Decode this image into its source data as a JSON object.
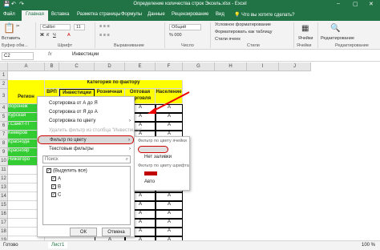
{
  "title": "Определение количества строк Эксель.xlsx - Excel",
  "tabs": [
    "Файл",
    "Главная",
    "Вставка",
    "Разметка страницы",
    "Формулы",
    "Данные",
    "Рецензирование",
    "Вид",
    "Что вы хотите сделать?"
  ],
  "ribbon": {
    "font": "Calibri",
    "size": "11",
    "groups": [
      "Буфер обм...",
      "Шрифт",
      "Выравнивание",
      "Число",
      "Стили",
      "Ячейки",
      "Редактирование"
    ],
    "styles": [
      "Условное форматирование",
      "Форматировать как таблицу",
      "Стили ячеек"
    ],
    "paste": "Вставить",
    "cells": "Ячейки",
    "edit": "Редактирование",
    "numfmt": "Общий"
  },
  "formula": {
    "cell": "C2",
    "value": "Инвестиции",
    "fx": "fx"
  },
  "cols": [
    "A",
    "B",
    "C",
    "D",
    "E",
    "F",
    "G",
    "H",
    "I",
    "J"
  ],
  "rows": [
    "1",
    "2",
    "3",
    "4",
    "5",
    "6",
    "7",
    "8",
    "9",
    "10",
    "11",
    "12",
    "13",
    "14",
    "15",
    "16",
    "17",
    "18",
    "19",
    "20"
  ],
  "header": {
    "region": "Регион",
    "category": "Категория по фактору",
    "vrp": "ВРП",
    "inv": "Инвестиции",
    "retail": "Розничная торговля",
    "wholesale": "Оптовая торговля",
    "pop": "Население"
  },
  "regions": [
    "Воронеж",
    "Курская",
    "г.Санкт-П",
    "Кемеров",
    "Краснода",
    "Краснояр",
    "Нижегоро"
  ],
  "values": [
    [
      "А",
      "А",
      "А"
    ],
    [
      "А",
      "А",
      "А"
    ],
    [
      "А",
      "А",
      "А"
    ],
    [
      "А",
      "А",
      "А"
    ],
    [
      "А",
      "А",
      "А"
    ],
    [
      "А",
      "А",
      "А"
    ],
    [
      "А",
      "А",
      "А"
    ],
    [
      "А",
      "А",
      "А"
    ],
    [
      "А",
      "А",
      "А"
    ],
    [
      "А",
      "А",
      "А"
    ],
    [
      "А",
      "А",
      "А"
    ],
    [
      "А",
      "А",
      "А"
    ],
    [
      "А",
      "А",
      "А"
    ],
    [
      "А",
      "А",
      "А"
    ],
    [
      "А",
      "А",
      "А"
    ],
    [
      "А",
      "А",
      "А"
    ]
  ],
  "filterMenu": {
    "items": [
      "Сортировка от А до Я",
      "Сортировка от Я до А",
      "Сортировка по цвету",
      "Удалить фильтр из столбца \"Инвестиции\"",
      "Фильтр по цвету",
      "Текстовые фильтры"
    ],
    "search": "Поиск",
    "list": [
      "(Выделить все)",
      "А",
      "В",
      "С"
    ],
    "ok": "ОК",
    "cancel": "Отмена"
  },
  "colorMenu": {
    "title": "Фильтр по цвету ячейки",
    "noFill": "Нет заливки",
    "fontTitle": "Фильтр по цвету шрифта",
    "auto": "Авто",
    "fillColor": "#e0e0e0",
    "fontColor": "#c00000"
  },
  "sheet": "Лист1",
  "status": "Готово",
  "zoom": "100 %"
}
